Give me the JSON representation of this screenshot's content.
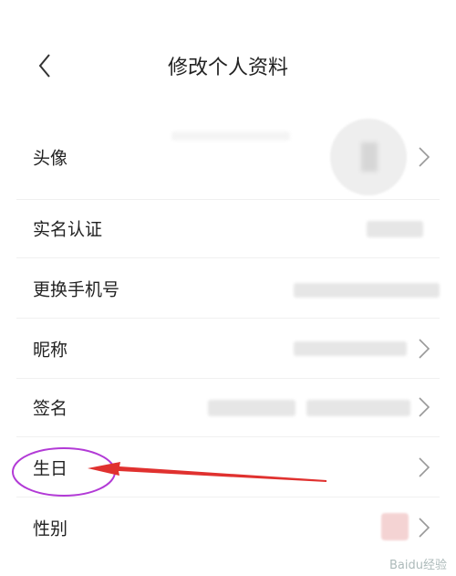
{
  "header": {
    "back_icon": "chevron-left-icon",
    "title": "修改个人资料"
  },
  "rows": [
    {
      "label": "头像",
      "has_arrow": true
    },
    {
      "label": "实名认证",
      "has_arrow": false
    },
    {
      "label": "更换手机号",
      "has_arrow": false
    },
    {
      "label": "昵称",
      "has_arrow": true
    },
    {
      "label": "签名",
      "has_arrow": true
    },
    {
      "label": "生日",
      "has_arrow": true
    },
    {
      "label": "性别",
      "has_arrow": true
    }
  ],
  "annotation": {
    "highlight_color": "#b23ad6",
    "arrow_color": "#e0312f"
  },
  "watermark": "Baidu经验"
}
